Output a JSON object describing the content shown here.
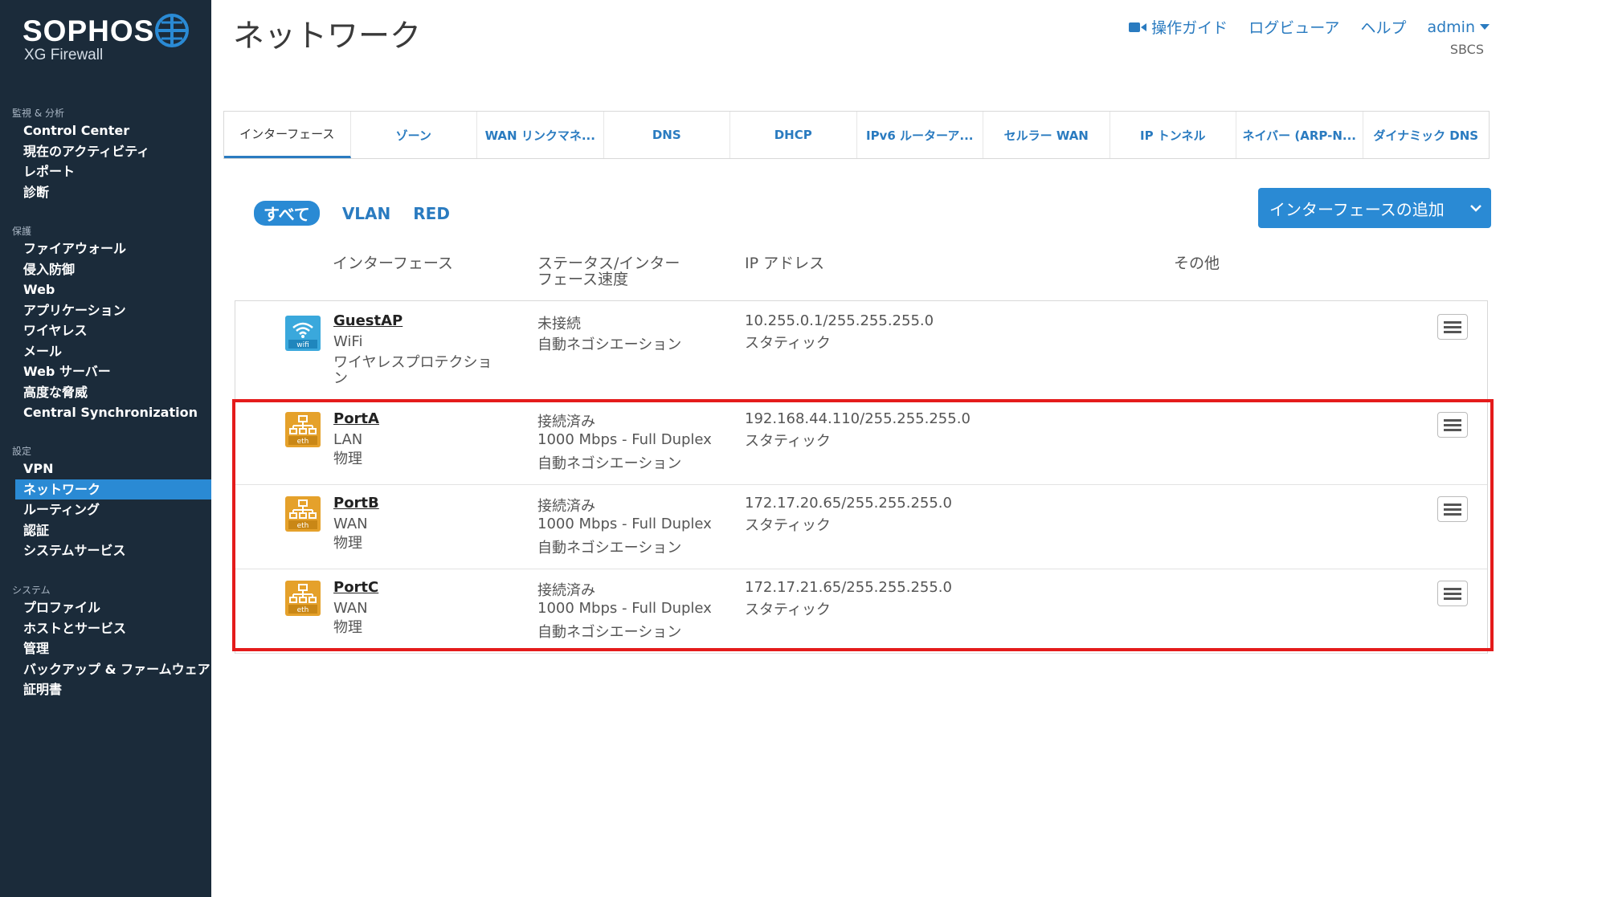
{
  "brand": {
    "name": "SOPHOS",
    "product": "XG Firewall"
  },
  "sidebar": {
    "groups": [
      {
        "title": "監視 & 分析",
        "items": [
          "Control Center",
          "現在のアクティビティ",
          "レポート",
          "診断"
        ]
      },
      {
        "title": "保護",
        "items": [
          "ファイアウォール",
          "侵入防御",
          "Web",
          "アプリケーション",
          "ワイヤレス",
          "メール",
          "Web サーバー",
          "高度な脅威",
          "Central Synchronization"
        ]
      },
      {
        "title": "設定",
        "items": [
          "VPN",
          "ネットワーク",
          "ルーティング",
          "認証",
          "システムサービス"
        ]
      },
      {
        "title": "システム",
        "items": [
          "プロファイル",
          "ホストとサービス",
          "管理",
          "バックアップ & ファームウェア",
          "証明書"
        ]
      }
    ],
    "active_item": "ネットワーク"
  },
  "header": {
    "title": "ネットワーク",
    "guide": "操作ガイド",
    "log_viewer": "ログビューア",
    "help": "ヘルプ",
    "user": "admin",
    "tenant": "SBCS"
  },
  "tabs": [
    "インターフェース",
    "ゾーン",
    "WAN リンクマネ...",
    "DNS",
    "DHCP",
    "IPv6 ルーターア...",
    "セルラー WAN",
    "IP トンネル",
    "ネイバー (ARP-N...",
    "ダイナミック DNS"
  ],
  "filters": [
    "すべて",
    "VLAN",
    "RED"
  ],
  "add_button": "インターフェースの追加",
  "columns": {
    "interface": "インターフェース",
    "status_line1": "ステータス/インター",
    "status_line2": "フェース速度",
    "ip": "IP アドレス",
    "other": "その他"
  },
  "rows": [
    {
      "name": "GuestAP",
      "icon": "wifi",
      "type": "WiFi",
      "sub": "ワイヤレスプロテクショ",
      "sub2": "ン",
      "status": "未接続",
      "speed": "",
      "nego": "自動ネゴシエーション",
      "ip": "10.255.0.1/255.255.255.0",
      "mode": "スタティック"
    },
    {
      "name": "PortA",
      "icon": "eth",
      "type": "LAN",
      "sub": "物理",
      "sub2": "",
      "status": "接続済み",
      "speed": "1000 Mbps - Full Duplex",
      "nego": "自動ネゴシエーション",
      "ip": "192.168.44.110/255.255.255.0",
      "mode": "スタティック"
    },
    {
      "name": "PortB",
      "icon": "eth",
      "type": "WAN",
      "sub": "物理",
      "sub2": "",
      "status": "接続済み",
      "speed": "1000 Mbps - Full Duplex",
      "nego": "自動ネゴシエーション",
      "ip": "172.17.20.65/255.255.255.0",
      "mode": "スタティック"
    },
    {
      "name": "PortC",
      "icon": "eth",
      "type": "WAN",
      "sub": "物理",
      "sub2": "",
      "status": "接続済み",
      "speed": "1000 Mbps - Full Duplex",
      "nego": "自動ネゴシエーション",
      "ip": "172.17.21.65/255.255.255.0",
      "mode": "スタティック"
    }
  ],
  "colors": {
    "accent": "#2a8ad4",
    "sidebar": "#1b2b3a",
    "highlight": "#e41b1b",
    "eth_icon": "#e5a12b",
    "wifi_icon": "#3aa8dc"
  }
}
